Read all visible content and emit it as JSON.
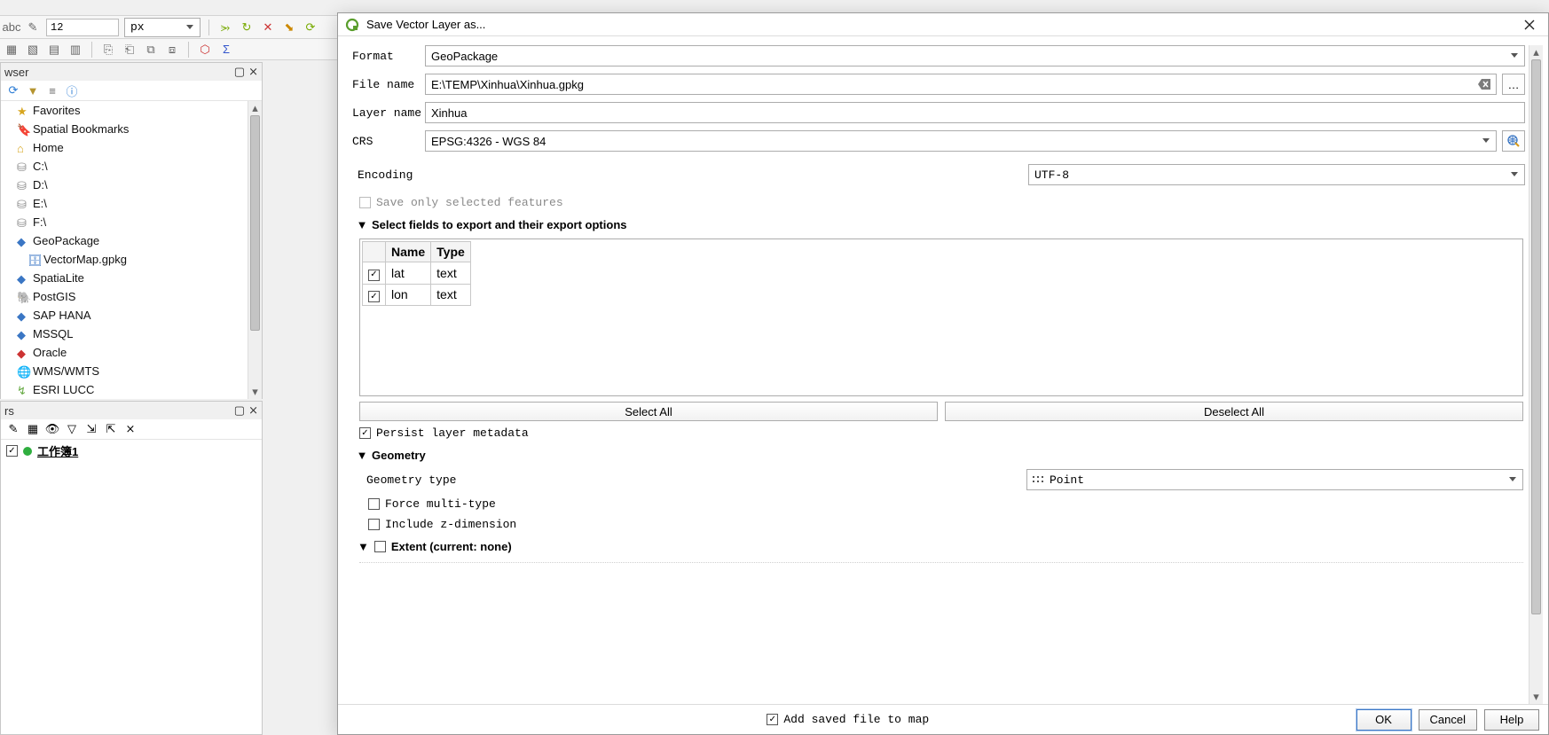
{
  "toolbar": {
    "font_size": "12",
    "unit": "px"
  },
  "browser_panel_title": "wser",
  "browser_items": [
    {
      "label": "Favorites",
      "icon": "star"
    },
    {
      "label": "Spatial Bookmarks",
      "icon": "bookmark"
    },
    {
      "label": "Home",
      "icon": "home"
    },
    {
      "label": "C:\\",
      "icon": "drive"
    },
    {
      "label": "D:\\",
      "icon": "drive"
    },
    {
      "label": "E:\\",
      "icon": "drive"
    },
    {
      "label": "F:\\",
      "icon": "drive"
    },
    {
      "label": "GeoPackage",
      "icon": "geopackage"
    },
    {
      "label": "VectorMap.gpkg",
      "icon": "db",
      "child": true
    },
    {
      "label": "SpatiaLite",
      "icon": "spatialite"
    },
    {
      "label": "PostGIS",
      "icon": "postgis"
    },
    {
      "label": "SAP HANA",
      "icon": "hana"
    },
    {
      "label": "MSSQL",
      "icon": "mssql"
    },
    {
      "label": "Oracle",
      "icon": "oracle"
    },
    {
      "label": "WMS/WMTS",
      "icon": "wms"
    },
    {
      "label": "ESRI LUCC",
      "icon": "esri",
      "arrow": true
    }
  ],
  "layers_panel_title": "rs",
  "layer_name": "工作簿1",
  "dialog": {
    "title": "Save Vector Layer as...",
    "format_label": "Format",
    "format_value": "GeoPackage",
    "filename_label": "File name",
    "filename_value": "E:\\TEMP\\Xinhua\\Xinhua.gpkg",
    "layername_label": "Layer name",
    "layername_value": "Xinhua",
    "crs_label": "CRS",
    "crs_value": "EPSG:4326 - WGS 84",
    "encoding_label": "Encoding",
    "encoding_value": "UTF-8",
    "save_only_selected": "Save only selected features",
    "fields_section": "Select fields to export and their export options",
    "fields_header_name": "Name",
    "fields_header_type": "Type",
    "fields": [
      {
        "name": "lat",
        "type": "text",
        "checked": true
      },
      {
        "name": "lon",
        "type": "text",
        "checked": true
      }
    ],
    "select_all": "Select All",
    "deselect_all": "Deselect All",
    "persist_metadata": "Persist layer metadata",
    "geometry_section": "Geometry",
    "geom_type_label": "Geometry type",
    "geom_type_value": "Point",
    "force_multi": "Force multi-type",
    "include_z": "Include z-dimension",
    "extent_section": "Extent (current: none)",
    "add_saved": "Add saved file to map",
    "ok": "OK",
    "cancel": "Cancel",
    "help": "Help",
    "browse_ellipsis": "…"
  }
}
